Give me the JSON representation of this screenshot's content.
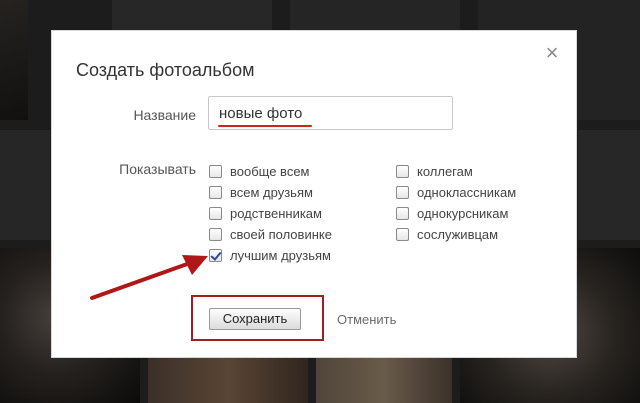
{
  "dialog": {
    "title": "Создать фотоальбом",
    "close_symbol": "×",
    "close_icon": "close-icon"
  },
  "name_field": {
    "label": "Название",
    "value": "новые фото"
  },
  "visibility": {
    "label": "Показывать",
    "left_options": [
      {
        "label": "вообще всем",
        "checked": false
      },
      {
        "label": "всем друзьям",
        "checked": false
      },
      {
        "label": "родственникам",
        "checked": false
      },
      {
        "label": "своей половинке",
        "checked": false
      },
      {
        "label": "лучшим друзьям",
        "checked": true
      }
    ],
    "right_options": [
      {
        "label": "коллегам",
        "checked": false
      },
      {
        "label": "одноклассникам",
        "checked": false
      },
      {
        "label": "однокурсникам",
        "checked": false
      },
      {
        "label": "сослуживцам",
        "checked": false
      }
    ]
  },
  "actions": {
    "save_label": "Сохранить",
    "cancel_label": "Отменить"
  },
  "annotation": {
    "highlight_color": "#a02020",
    "underline_color": "#d42020",
    "arrow_color": "#b01818"
  }
}
